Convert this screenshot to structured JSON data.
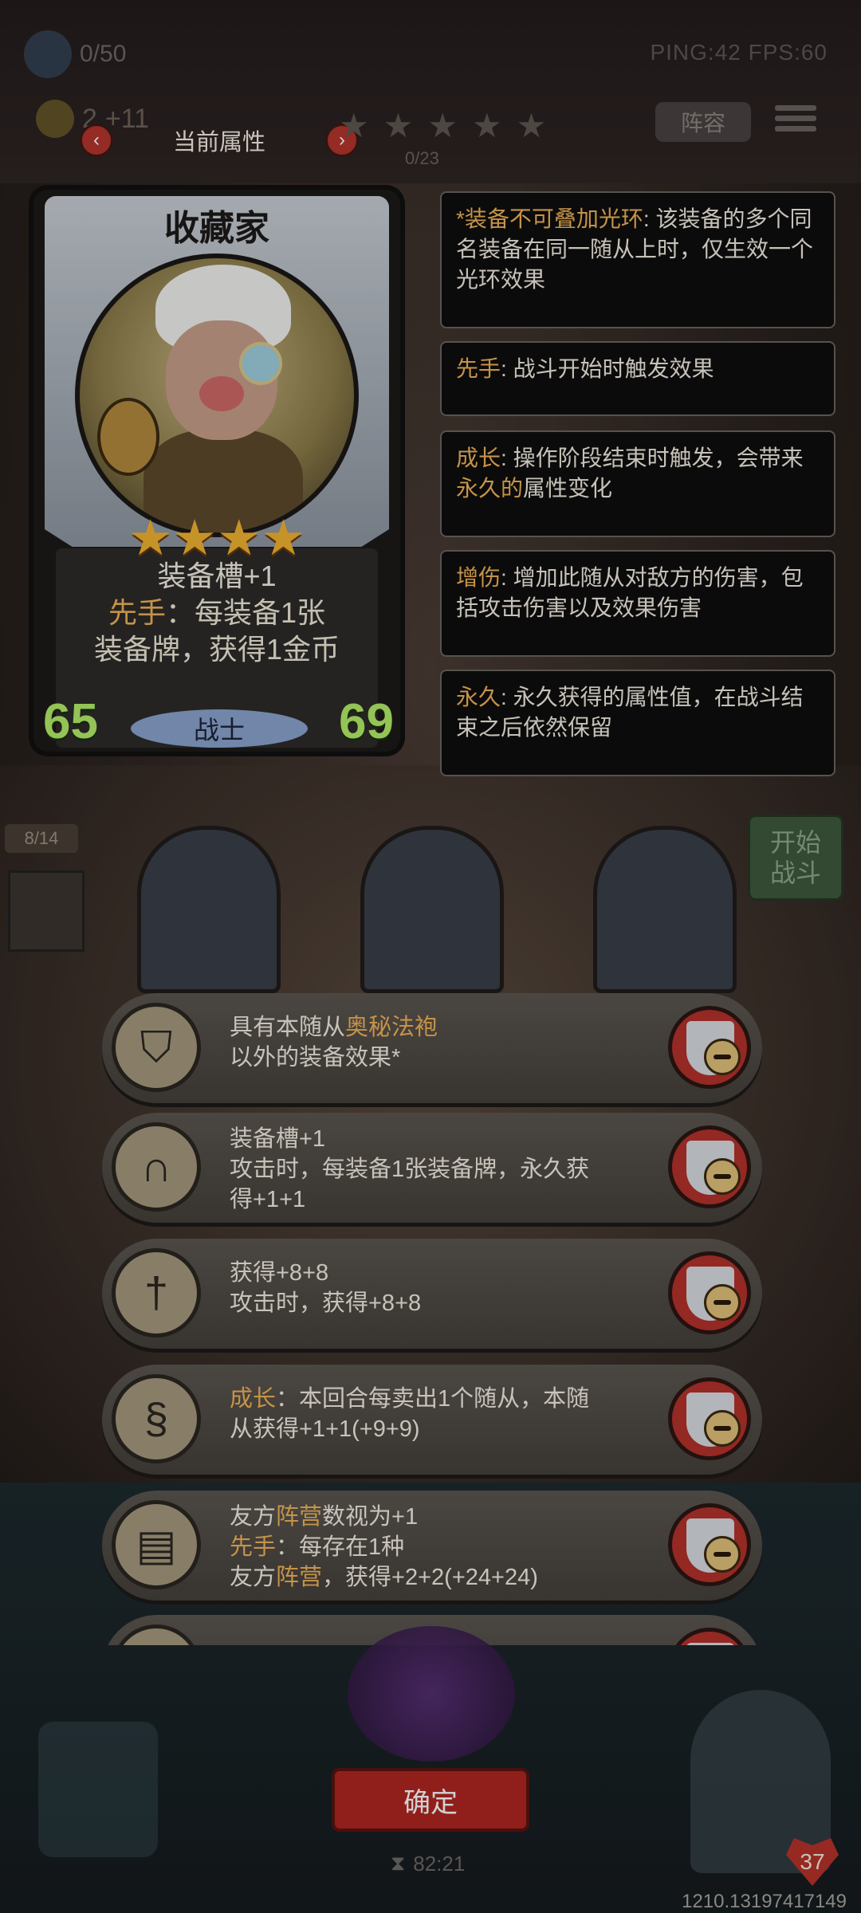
{
  "hud": {
    "population": "0/50",
    "perf": "PING:42   FPS:60",
    "gold": "2",
    "gold_gain": "+11",
    "team_label": "阵容"
  },
  "attr_panel": {
    "title": "当前属性",
    "prev_icon": "chevron-left-icon",
    "next_icon": "chevron-right-icon",
    "progress": "0/23"
  },
  "card": {
    "name": "收藏家",
    "stars": "★★★★",
    "line1": "装备槽+1",
    "line2_key": "先手",
    "line2_rest": "：每装备1张",
    "line3": "装备牌，获得1金币",
    "attack": "65",
    "health": "69",
    "class": "战士"
  },
  "keywords": [
    {
      "key": "*装备不可叠加光环",
      "text": ": 该装备的多个同名装备在同一随从上时，仅生效一个光环效果"
    },
    {
      "key": "先手",
      "text": ": 战斗开始时触发效果"
    },
    {
      "key": "成长",
      "text": ": 操作阶段结束时触发，会带来",
      "key2": "永久的",
      "text2": "属性变化"
    },
    {
      "key": "增伤",
      "text": ": 增加此随从对敌方的伤害，包括攻击伤害以及效果伤害"
    },
    {
      "key": "永久",
      "text": ": 永久获得的属性值，在战斗结束之后依然保留"
    }
  ],
  "board": {
    "count": "8/14",
    "start_line1": "开始",
    "start_line2": "战斗"
  },
  "equipment": [
    {
      "icon": "robe-icon",
      "l1a": "具有本随从",
      "l1b": "奥秘法袍",
      "l2": "以外的装备效果*"
    },
    {
      "icon": "horseshoe-icon",
      "l1": "装备槽+1",
      "l2": "攻击时，每装备1张装备牌，永久获",
      "l3": "得+1+1"
    },
    {
      "icon": "sword-icon",
      "l1": "获得+8+8",
      "l2": "攻击时，获得+8+8"
    },
    {
      "icon": "vine-icon",
      "l1a": "成长",
      "l1b": "：本回合每卖出1个随从，本随",
      "l2": "从获得+1+1(+9+9)"
    },
    {
      "icon": "book-icon",
      "l1a": "友方",
      "l1b": "阵营",
      "l1c": "数视为+1",
      "l2a": "先手",
      "l2b": "：每存在1种",
      "l3a": "友方",
      "l3b": "阵营",
      "l3c": "，获得+2+2(+24+24)"
    }
  ],
  "footer": {
    "confirm": "确定",
    "timer": "82:21",
    "hp": "37",
    "coords": "1210.13197417149"
  },
  "colors": {
    "highlight": "#f1b45a",
    "attack_health": "#b5ef6a",
    "confirm_red": "#b02721"
  }
}
